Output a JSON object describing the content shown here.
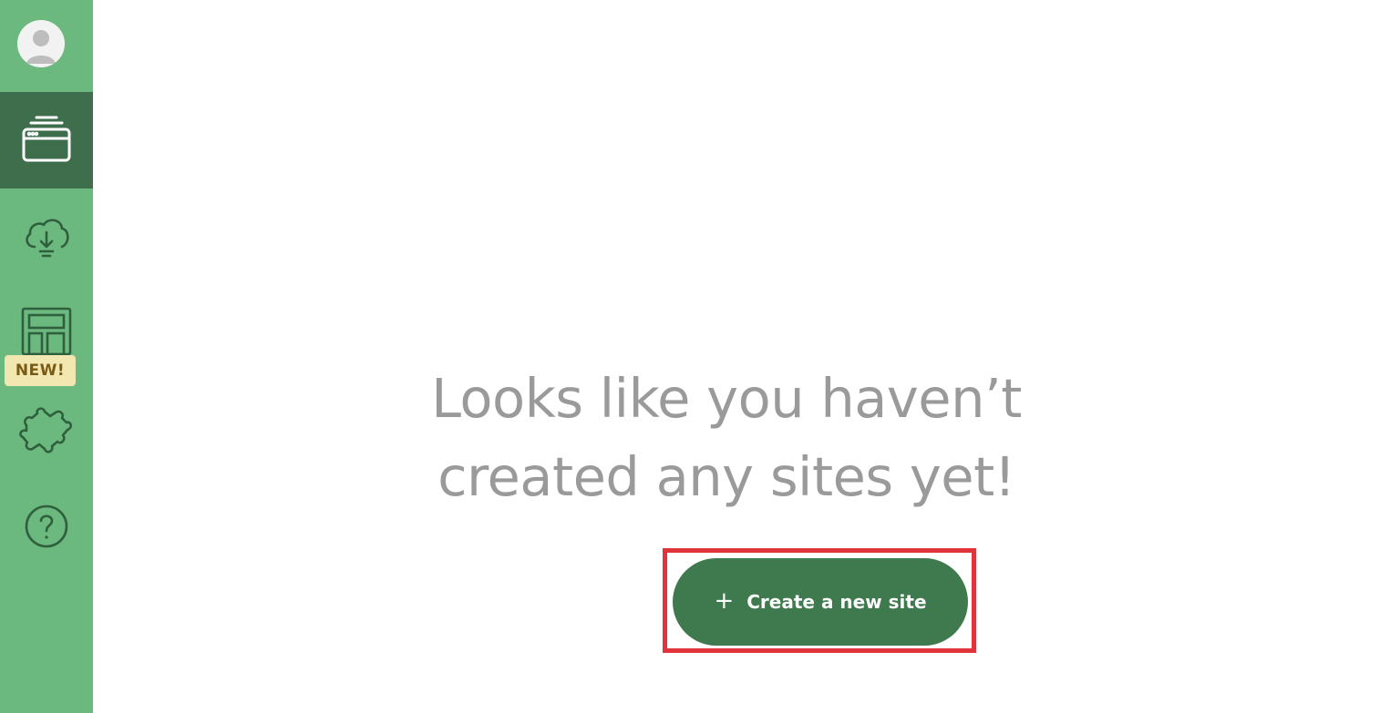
{
  "sidebar": {
    "badge_label": "NEW!",
    "items": [
      {
        "name": "sites",
        "icon": "browser-window-stack-icon",
        "active": true
      },
      {
        "name": "cloud-deploy",
        "icon": "cloud-download-icon",
        "active": false
      },
      {
        "name": "templates",
        "icon": "layout-grid-icon",
        "active": false
      },
      {
        "name": "integrations",
        "icon": "puzzle-icon",
        "active": false
      },
      {
        "name": "help",
        "icon": "help-circle-icon",
        "active": false
      }
    ]
  },
  "main": {
    "empty_title_line1": "Looks like you haven’t",
    "empty_title_line2": "created any sites yet!",
    "create_button": {
      "icon": "plus-icon",
      "icon_glyph": "+",
      "label": "Create a new site"
    }
  },
  "colors": {
    "sidebar_bg": "#6bb97f",
    "sidebar_active_bg": "#3e6e4b",
    "button_bg": "#3f7a4e",
    "highlight_border": "#e0333c",
    "empty_text": "#9a9a9a",
    "badge_bg": "#f3e7b1"
  }
}
